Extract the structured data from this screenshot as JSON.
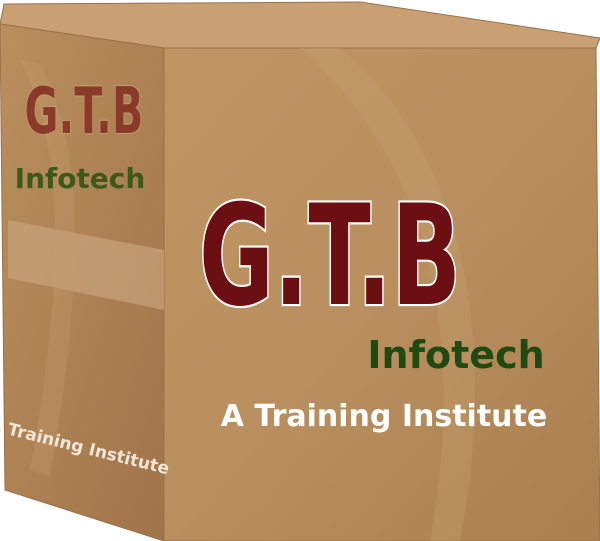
{
  "logo": {
    "brand": "G.T.B",
    "name": "Infotech",
    "tagline": "A Training Institute"
  },
  "colors": {
    "brand_maroon": "#6b0f12",
    "brand_green": "#1f4a12",
    "side_maroon": "#8a3a28",
    "side_green": "#3b5a1a",
    "box_front": "#b98f5f",
    "box_side": "#b08556",
    "box_top": "#cda67a",
    "tagline_white": "#ffffff"
  }
}
